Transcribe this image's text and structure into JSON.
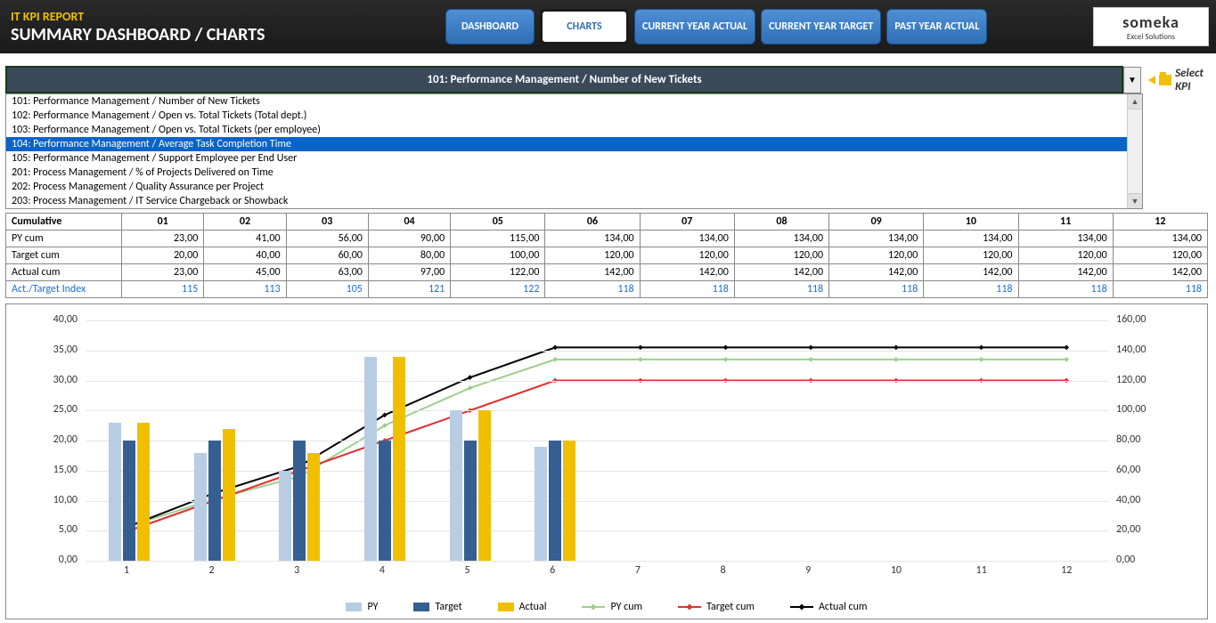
{
  "header": {
    "report_title": "IT KPI REPORT",
    "page_title": "SUMMARY DASHBOARD / CHARTS",
    "nav": {
      "dashboard": "DASHBOARD",
      "charts": "CHARTS",
      "cya": "CURRENT YEAR ACTUAL",
      "cyt": "CURRENT YEAR TARGET",
      "pya": "PAST YEAR ACTUAL"
    },
    "logo_main": "someka",
    "logo_sub": "Excel Solutions"
  },
  "kpi_selector": {
    "current": "101: Performance Management / Number of New Tickets",
    "label": "Select KPI",
    "options": [
      "101: Performance Management / Number of New Tickets",
      "102: Performance Management / Open vs. Total Tickets (Total dept.)",
      "103: Performance Management / Open vs. Total Tickets (per employee)",
      "104: Performance Management / Average Task Completion Time",
      "105: Performance Management / Support Employee per End User",
      "201: Process Management / % of Projects Delivered on Time",
      "202: Process Management / Quality Assurance per Project",
      "203: Process Management / IT Service Chargeback or Showback"
    ],
    "highlighted_index": 3
  },
  "table": {
    "section_label": "Cumulative",
    "cols": [
      "01",
      "02",
      "03",
      "04",
      "05",
      "06",
      "07",
      "08",
      "09",
      "10",
      "11",
      "12"
    ],
    "rows": [
      {
        "label": "PY cum",
        "vals": [
          "23,00",
          "41,00",
          "56,00",
          "90,00",
          "115,00",
          "134,00",
          "134,00",
          "134,00",
          "134,00",
          "134,00",
          "134,00",
          "134,00"
        ]
      },
      {
        "label": "Target cum",
        "vals": [
          "20,00",
          "40,00",
          "60,00",
          "80,00",
          "100,00",
          "120,00",
          "120,00",
          "120,00",
          "120,00",
          "120,00",
          "120,00",
          "120,00"
        ]
      },
      {
        "label": "Actual cum",
        "vals": [
          "23,00",
          "45,00",
          "63,00",
          "97,00",
          "122,00",
          "142,00",
          "142,00",
          "142,00",
          "142,00",
          "142,00",
          "142,00",
          "142,00"
        ]
      },
      {
        "label": "Act./Target Index",
        "vals": [
          "115",
          "113",
          "105",
          "121",
          "122",
          "118",
          "118",
          "118",
          "118",
          "118",
          "118",
          "118"
        ],
        "idx": true
      }
    ]
  },
  "chart_data": {
    "type": "bar+line",
    "categories": [
      "1",
      "2",
      "3",
      "4",
      "5",
      "6",
      "7",
      "8",
      "9",
      "10",
      "11",
      "12"
    ],
    "left_axis": {
      "min": 0,
      "max": 40,
      "step": 5,
      "labels": [
        "0,00",
        "5,00",
        "10,00",
        "15,00",
        "20,00",
        "25,00",
        "30,00",
        "35,00",
        "40,00"
      ]
    },
    "right_axis": {
      "min": 0,
      "max": 160,
      "step": 20,
      "labels": [
        "0,00",
        "20,00",
        "40,00",
        "60,00",
        "80,00",
        "100,00",
        "120,00",
        "140,00",
        "160,00"
      ]
    },
    "bar_series": [
      {
        "name": "PY",
        "color": "#b8cce4",
        "values": [
          23,
          18,
          15,
          34,
          25,
          19,
          0,
          0,
          0,
          0,
          0,
          0
        ]
      },
      {
        "name": "Target",
        "color": "#365f91",
        "values": [
          20,
          20,
          20,
          20,
          20,
          20,
          0,
          0,
          0,
          0,
          0,
          0
        ]
      },
      {
        "name": "Actual",
        "color": "#f0c000",
        "values": [
          23,
          22,
          18,
          34,
          25,
          20,
          0,
          0,
          0,
          0,
          0,
          0
        ]
      }
    ],
    "line_series": [
      {
        "name": "PY cum",
        "color": "#9dcf8a",
        "values": [
          23,
          41,
          56,
          90,
          115,
          134,
          134,
          134,
          134,
          134,
          134,
          134
        ]
      },
      {
        "name": "Target cum",
        "color": "#e03030",
        "values": [
          20,
          40,
          60,
          80,
          100,
          120,
          120,
          120,
          120,
          120,
          120,
          120
        ]
      },
      {
        "name": "Actual cum",
        "color": "#000000",
        "values": [
          23,
          45,
          63,
          97,
          122,
          142,
          142,
          142,
          142,
          142,
          142,
          142
        ]
      }
    ],
    "legend": {
      "PY": "PY",
      "Target": "Target",
      "Actual": "Actual",
      "PYcum": "PY cum",
      "Targetcum": "Target cum",
      "Actualcum": "Actual cum"
    }
  }
}
